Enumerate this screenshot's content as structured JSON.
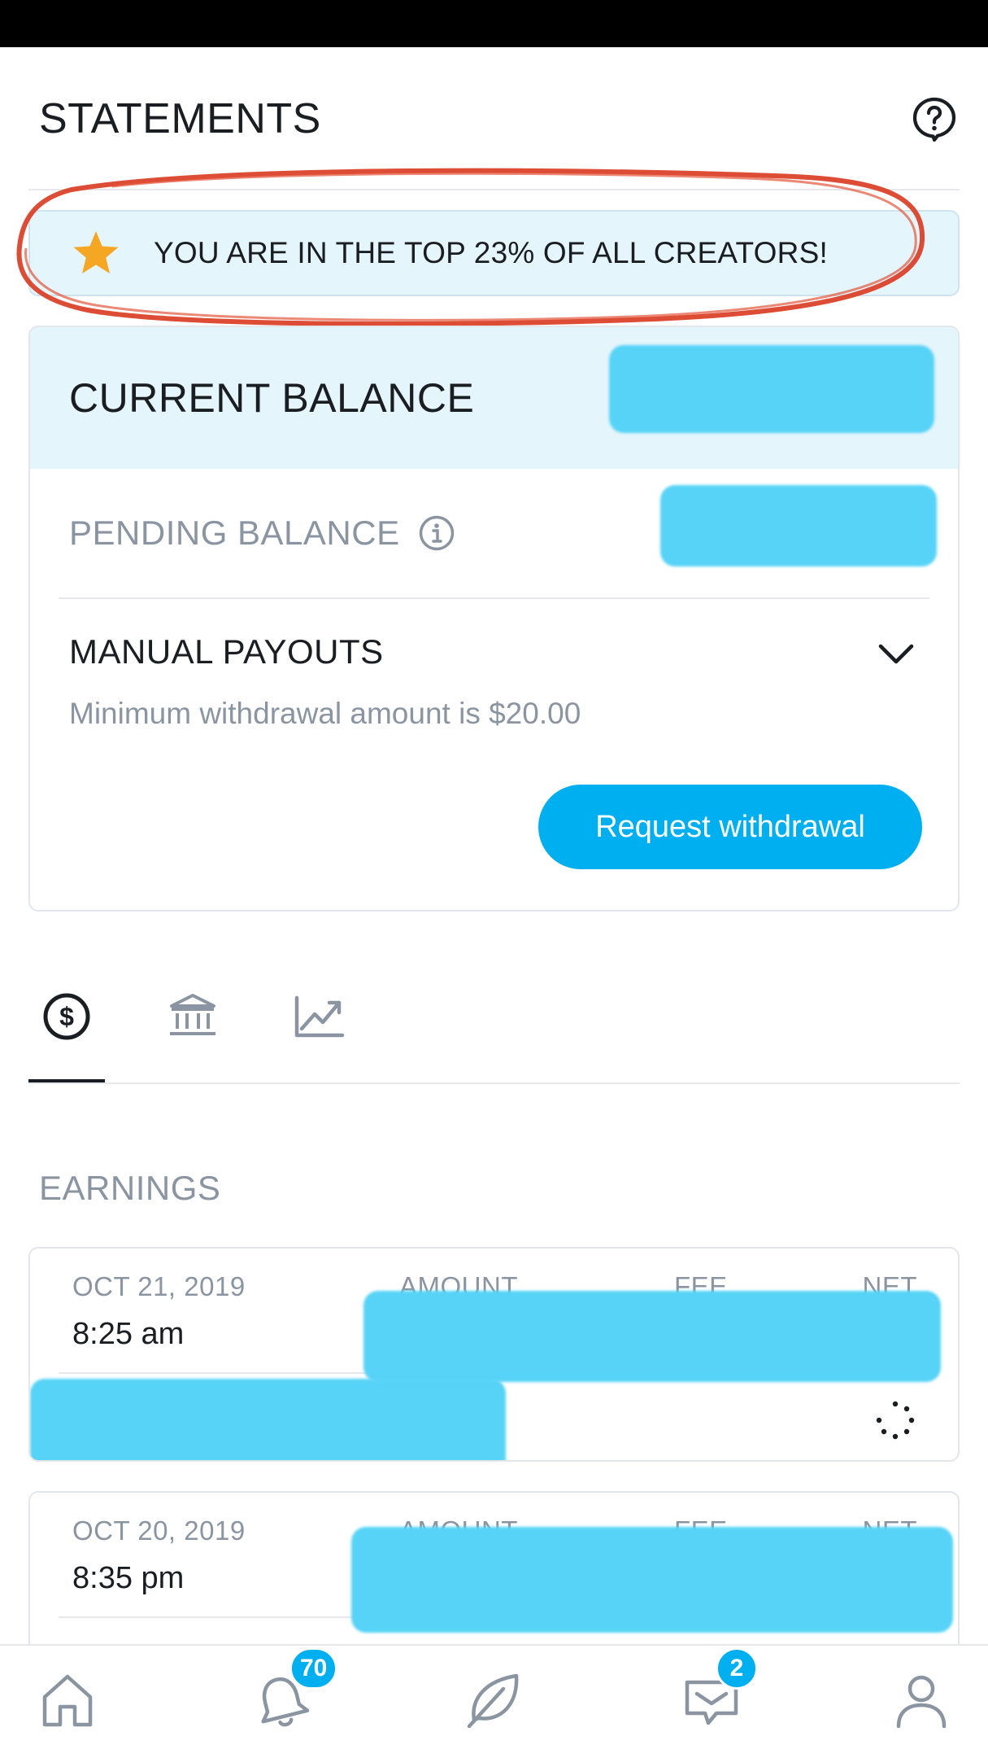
{
  "header": {
    "title": "STATEMENTS",
    "help_icon": "question-circle-icon"
  },
  "banner": {
    "icon": "star-icon",
    "star_color": "#f5a623",
    "text": "YOU ARE IN THE TOP 23% OF ALL CREATORS!",
    "annotation_color": "#d9391f"
  },
  "balance": {
    "current_label": "CURRENT BALANCE",
    "pending_label": "PENDING BALANCE",
    "info_icon": "info-circle-icon"
  },
  "payouts": {
    "title": "MANUAL PAYOUTS",
    "subtitle": "Minimum withdrawal amount is $20.00",
    "request_button": "Request withdrawal",
    "accent_color": "#00aff0"
  },
  "tabs": [
    {
      "name": "earnings-tab",
      "icon": "dollar-circle-icon",
      "active": true
    },
    {
      "name": "payouts-tab",
      "icon": "bank-icon",
      "active": false
    },
    {
      "name": "statistics-tab",
      "icon": "chart-line-icon",
      "active": false
    }
  ],
  "earnings": {
    "title": "EARNINGS",
    "columns": {
      "amount": "AMOUNT",
      "fee": "FEE",
      "net": "NET"
    },
    "rows": [
      {
        "date": "OCT 21, 2019",
        "time": "8:25 am"
      },
      {
        "date": "OCT 20, 2019",
        "time": "8:35 pm"
      }
    ]
  },
  "bottom_nav": {
    "items": [
      {
        "name": "home",
        "icon": "home-icon"
      },
      {
        "name": "notifications",
        "icon": "bell-icon",
        "badge": "70"
      },
      {
        "name": "new-post",
        "icon": "leaf-icon"
      },
      {
        "name": "messages",
        "icon": "chat-icon",
        "badge": "2"
      },
      {
        "name": "profile",
        "icon": "user-icon"
      }
    ]
  }
}
